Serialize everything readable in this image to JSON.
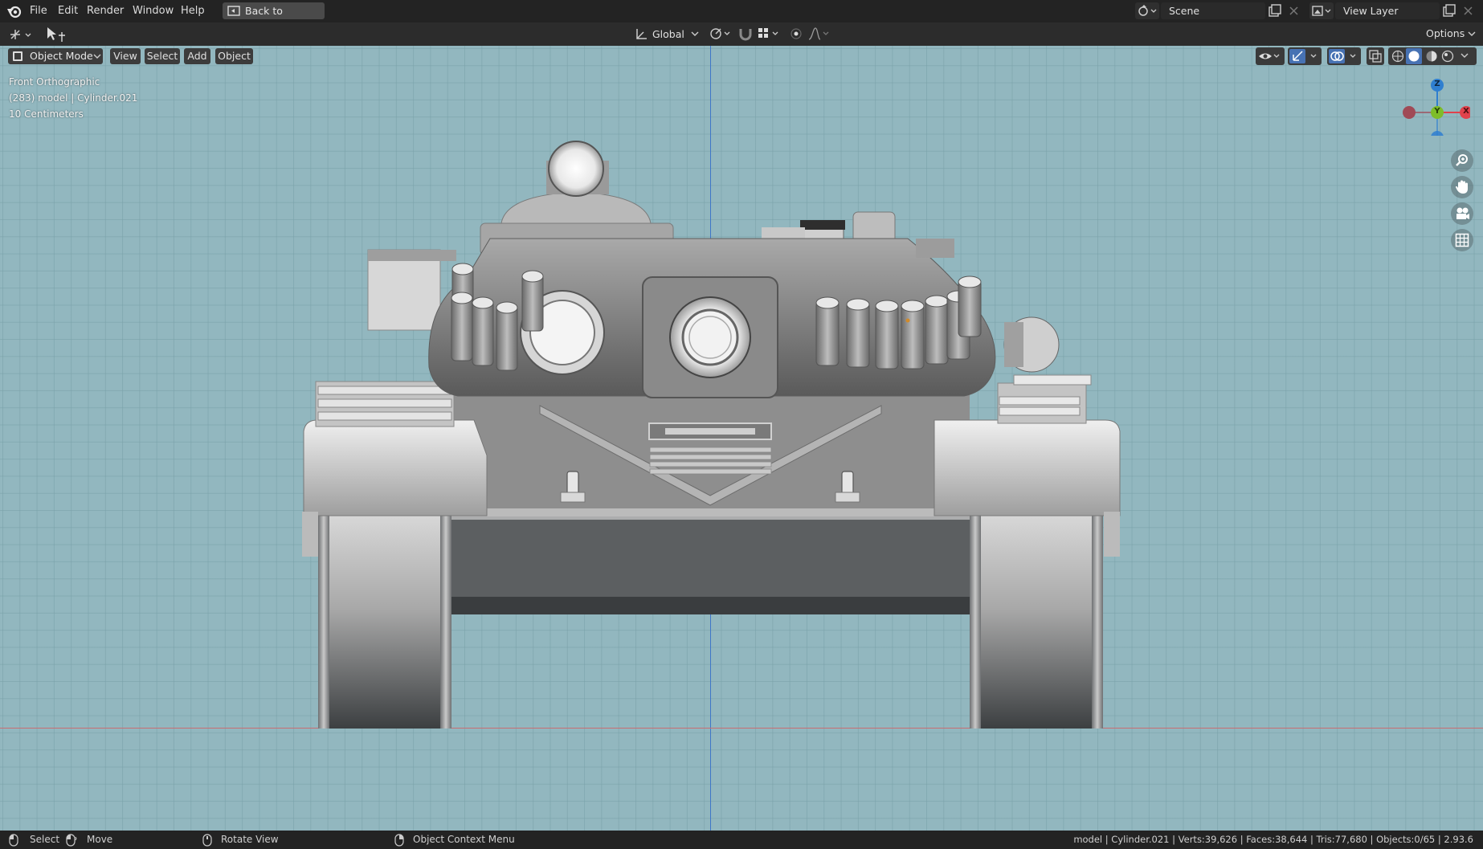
{
  "menubar": {
    "items": [
      "File",
      "Edit",
      "Render",
      "Window",
      "Help"
    ],
    "back_button": "Back to Previous",
    "scene_label": "Scene",
    "view_layer_label": "View Layer"
  },
  "header": {
    "transform_orientation": "Global",
    "options_label": "Options",
    "mode": "Object Mode",
    "menus": [
      "View",
      "Select",
      "Add",
      "Object"
    ]
  },
  "viewport": {
    "view_name": "Front Orthographic",
    "object_info": "(283) model | Cylinder.021",
    "scale_info": "10 Centimeters",
    "gizmo_axes": {
      "z": "Z",
      "y": "Y",
      "x": "X"
    },
    "colors": {
      "background": "#92b7bf",
      "z_axis": "#2f7fd0",
      "y_axis": "#7ebd2a",
      "x_axis": "#e0424c",
      "neg_x": "#a04a56"
    }
  },
  "statusbar": {
    "select": "Select",
    "move": "Move",
    "rotate": "Rotate View",
    "context": "Object Context Menu",
    "stats": "model | Cylinder.021 | Verts:39,626 | Faces:38,644 | Tris:77,680 | Objects:0/65 | 2.93.6"
  }
}
